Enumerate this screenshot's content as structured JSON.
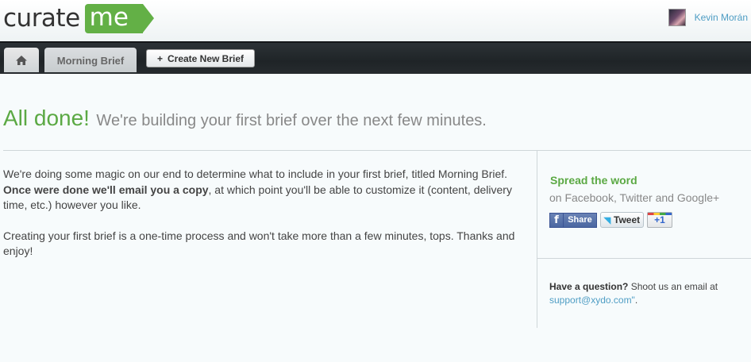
{
  "header": {
    "logo_part1": "curate",
    "logo_part2": "me",
    "user_name": "Kevin Morán"
  },
  "nav": {
    "active_tab": "Morning Brief",
    "create_label": "Create New Brief",
    "create_prefix": "+"
  },
  "headline": {
    "big": "All done!",
    "rest": "We're building your first brief over the next few minutes."
  },
  "body": {
    "p1_a": "We're doing some magic on our end to determine what to include in your first brief, titled Morning Brief. ",
    "p1_bold": "Once were done we'll email you a copy",
    "p1_b": ", at which point you'll be able to customize it (content, delivery time, etc.) however you like.",
    "p2": "Creating your first brief is a one-time process and won't take more than a few minutes, tops. Thanks and enjoy!"
  },
  "sidebar": {
    "spread_title": "Spread the word",
    "spread_sub": "on Facebook, Twitter and Google+",
    "fb_label": "Share",
    "tweet_label": "Tweet",
    "gplus_label": "+1",
    "question_bold": "Have a question?",
    "question_text": " Shoot us an email at ",
    "email": "support@xydo.com\"",
    "question_end": "."
  },
  "colors": {
    "brand_green": "#63b046",
    "link_blue": "#4e9dc4",
    "nav_dark": "#1f2427"
  }
}
